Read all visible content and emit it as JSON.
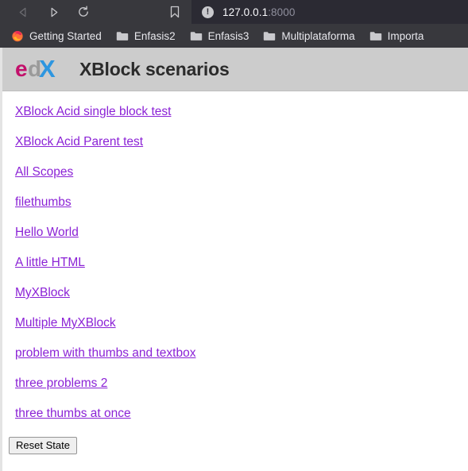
{
  "browser": {
    "nav": {
      "back_label": "Back",
      "forward_label": "Forward",
      "reload_label": "Reload",
      "bookmark_label": "Bookmark this page"
    },
    "urlbar": {
      "security_icon": "insecure-warning-icon",
      "security_glyph": "!",
      "host": "127.0.0.1",
      "port": ":8000",
      "full_url": "127.0.0.1:8000"
    },
    "bookmarks": [
      {
        "label": "Getting Started",
        "icon": "firefox-icon"
      },
      {
        "label": "Enfasis2",
        "icon": "folder-icon"
      },
      {
        "label": "Enfasis3",
        "icon": "folder-icon"
      },
      {
        "label": "Multiplataforma",
        "icon": "folder-icon"
      },
      {
        "label": "Importa",
        "icon": "folder-icon"
      }
    ]
  },
  "page": {
    "logo_alt": "edX",
    "logo_parts": {
      "e": "e",
      "d": "d",
      "x": "X"
    },
    "title": "XBlock scenarios",
    "colors": {
      "header_background": "#cccccc",
      "link": "#8b22d6",
      "logo_e": "#c2106b",
      "logo_d": "#9a9a9a",
      "logo_x": "#2d96e0",
      "chrome_background": "#38383d",
      "urlbar_background": "#2b2a33"
    },
    "scenarios": [
      {
        "label": "XBlock Acid single block test"
      },
      {
        "label": "XBlock Acid Parent test"
      },
      {
        "label": "All Scopes"
      },
      {
        "label": "filethumbs"
      },
      {
        "label": "Hello World"
      },
      {
        "label": "A little HTML"
      },
      {
        "label": "MyXBlock"
      },
      {
        "label": "Multiple MyXBlock"
      },
      {
        "label": "problem with thumbs and textbox"
      },
      {
        "label": "three problems 2"
      },
      {
        "label": "three thumbs at once"
      }
    ],
    "reset_button_label": "Reset State"
  }
}
